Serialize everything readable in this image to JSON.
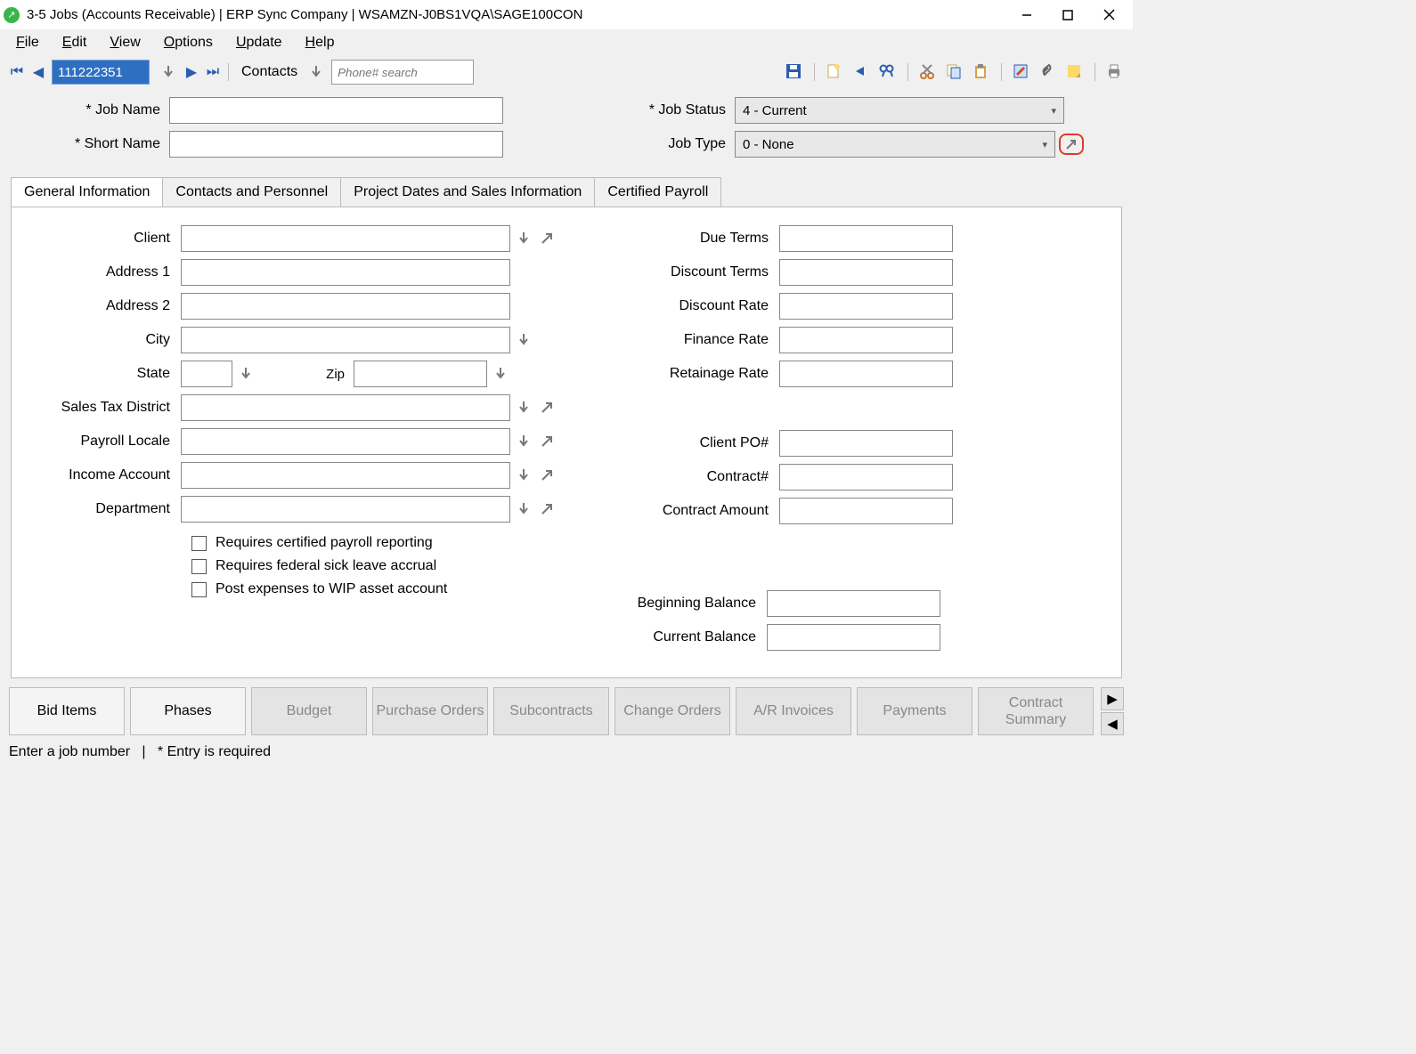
{
  "title": "3-5 Jobs (Accounts Receivable)  |  ERP Sync Company  |  WSAMZN-J0BS1VQA\\SAGE100CON",
  "menu": {
    "file": "File",
    "edit": "Edit",
    "view": "View",
    "options": "Options",
    "update": "Update",
    "help": "Help"
  },
  "nav": {
    "record": "111222351",
    "contacts": "Contacts",
    "phone_ph": "Phone# search"
  },
  "header": {
    "job_name_label": "* Job Name",
    "short_name_label": "* Short Name",
    "job_status_label": "* Job Status",
    "job_type_label": "Job Type",
    "job_status_value": "4 - Current",
    "job_type_value": "0 - None"
  },
  "tabs": {
    "t0": "General Information",
    "t1": "Contacts and Personnel",
    "t2": "Project Dates and Sales Information",
    "t3": "Certified Payroll"
  },
  "left": {
    "client": "Client",
    "addr1": "Address 1",
    "addr2": "Address 2",
    "city": "City",
    "state": "State",
    "zip": "Zip",
    "std": "Sales Tax District",
    "payroll": "Payroll Locale",
    "income": "Income Account",
    "dept": "Department"
  },
  "checks": {
    "c1": "Requires certified payroll reporting",
    "c2": "Requires federal sick leave accrual",
    "c3": "Post expenses to WIP asset account"
  },
  "right": {
    "due": "Due Terms",
    "disc_terms": "Discount Terms",
    "disc_rate": "Discount Rate",
    "fin_rate": "Finance Rate",
    "ret_rate": "Retainage Rate",
    "client_po": "Client PO#",
    "contract_no": "Contract#",
    "contract_amt": "Contract Amount",
    "beg_bal": "Beginning Balance",
    "cur_bal": "Current Balance"
  },
  "buttons": {
    "b0": "Bid Items",
    "b1": "Phases",
    "b2": "Budget",
    "b3": "Purchase Orders",
    "b4": "Subcontracts",
    "b5": "Change Orders",
    "b6": "A/R Invoices",
    "b7": "Payments",
    "b8": "Contract Summary"
  },
  "status": {
    "msg": "Enter a job number",
    "req": "* Entry is required"
  }
}
